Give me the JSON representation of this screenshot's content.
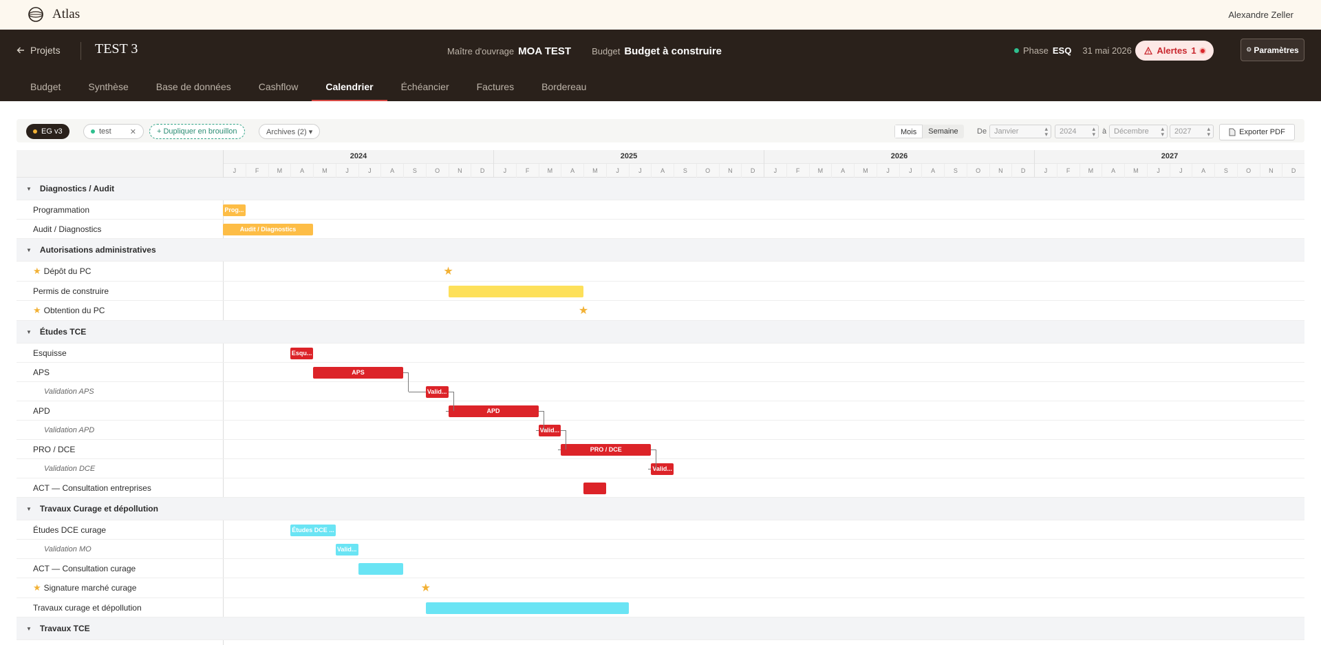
{
  "app": {
    "brand": "Atlas",
    "user": "Alexandre Zeller"
  },
  "header": {
    "back_label": "Projets",
    "project_title": "TEST 3",
    "moa_label": "Maître d'ouvrage",
    "moa_value": "MOA TEST",
    "budget_label": "Budget",
    "budget_value": "Budget à construire",
    "phase_label": "Phase",
    "phase_value": "ESQ",
    "date": "31 mai 2026",
    "alerts_label": "Alertes",
    "alerts_count": "1",
    "params_label": "Paramètres",
    "status_color": "#2fbf8f"
  },
  "tabs": [
    {
      "label": "Budget",
      "active": false
    },
    {
      "label": "Synthèse",
      "active": false
    },
    {
      "label": "Base de données",
      "active": false
    },
    {
      "label": "Cashflow",
      "active": false
    },
    {
      "label": "Calendrier",
      "active": true
    },
    {
      "label": "Échéancier",
      "active": false
    },
    {
      "label": "Factures",
      "active": false
    },
    {
      "label": "Bordereau",
      "active": false
    }
  ],
  "toolbar": {
    "chip_active": "EG v3",
    "chip_test": "test",
    "chip_duplicate": "+ Dupliquer en brouillon",
    "chip_archives": "Archives (2) ▾",
    "view_month": "Mois",
    "view_week": "Semaine",
    "from_label": "De",
    "from_month": "Janvier",
    "from_year": "2024",
    "to_label": "à",
    "to_month": "Décembre",
    "to_year": "2027",
    "export_label": "Exporter PDF"
  },
  "gantt": {
    "years": [
      "2024",
      "2025",
      "2026",
      "2027"
    ],
    "months": [
      "J",
      "F",
      "M",
      "A",
      "M",
      "J",
      "J",
      "A",
      "S",
      "O",
      "N",
      "D"
    ],
    "colors": {
      "orange": "#fdbd46",
      "yellow": "#fde05a",
      "red": "#dc2328",
      "cyan": "#6ae4f4",
      "milestone": "#f2b135"
    },
    "rows": [
      {
        "kind": "group",
        "label": "Diagnostics / Audit"
      },
      {
        "kind": "task",
        "label": "Programmation",
        "bar": {
          "start": 0,
          "end": 1,
          "color": "orange",
          "text": "Prog..."
        }
      },
      {
        "kind": "task",
        "label": "Audit / Diagnostics",
        "bar": {
          "start": 0,
          "end": 4,
          "color": "orange",
          "text": "Audit / Diagnostics"
        }
      },
      {
        "kind": "group",
        "label": "Autorisations administratives"
      },
      {
        "kind": "ms",
        "label": "Dépôt du PC",
        "milestone": 10
      },
      {
        "kind": "task",
        "label": "Permis de construire",
        "bar": {
          "start": 10,
          "end": 16,
          "color": "yellow",
          "text": ""
        }
      },
      {
        "kind": "ms",
        "label": "Obtention du PC",
        "milestone": 16
      },
      {
        "kind": "group",
        "label": "Études TCE"
      },
      {
        "kind": "task",
        "label": "Esquisse",
        "bar": {
          "start": 3,
          "end": 4,
          "color": "red",
          "text": "Esqu..."
        }
      },
      {
        "kind": "task",
        "label": "APS",
        "bar": {
          "start": 4,
          "end": 8,
          "color": "red",
          "text": "APS"
        }
      },
      {
        "kind": "sub",
        "label": "Validation APS",
        "bar": {
          "start": 9,
          "end": 10,
          "color": "red",
          "text": "Valid..."
        }
      },
      {
        "kind": "task",
        "label": "APD",
        "bar": {
          "start": 10,
          "end": 14,
          "color": "red",
          "text": "APD"
        }
      },
      {
        "kind": "sub",
        "label": "Validation APD",
        "bar": {
          "start": 14,
          "end": 15,
          "color": "red",
          "text": "Valid..."
        }
      },
      {
        "kind": "task",
        "label": "PRO / DCE",
        "bar": {
          "start": 15,
          "end": 19,
          "color": "red",
          "text": "PRO / DCE"
        }
      },
      {
        "kind": "sub",
        "label": "Validation DCE",
        "bar": {
          "start": 19,
          "end": 20,
          "color": "red",
          "text": "Valid..."
        }
      },
      {
        "kind": "task",
        "label": "ACT — Consultation entreprises",
        "bar": {
          "start": 16,
          "end": 17,
          "color": "red",
          "text": ""
        }
      },
      {
        "kind": "group",
        "label": "Travaux Curage et dépollution"
      },
      {
        "kind": "task",
        "label": "Études DCE curage",
        "bar": {
          "start": 3,
          "end": 5,
          "color": "cyan",
          "text": "Études DCE ..."
        }
      },
      {
        "kind": "sub",
        "label": "Validation MO",
        "bar": {
          "start": 5,
          "end": 6,
          "color": "cyan",
          "text": "Valid..."
        }
      },
      {
        "kind": "task",
        "label": "ACT — Consultation curage",
        "bar": {
          "start": 6,
          "end": 8,
          "color": "cyan",
          "text": ""
        }
      },
      {
        "kind": "ms",
        "label": "Signature marché curage",
        "milestone": 9
      },
      {
        "kind": "task",
        "label": "Travaux curage et dépollution",
        "bar": {
          "start": 9,
          "end": 18,
          "color": "cyan",
          "text": ""
        }
      },
      {
        "kind": "group",
        "label": "Travaux TCE"
      }
    ]
  }
}
